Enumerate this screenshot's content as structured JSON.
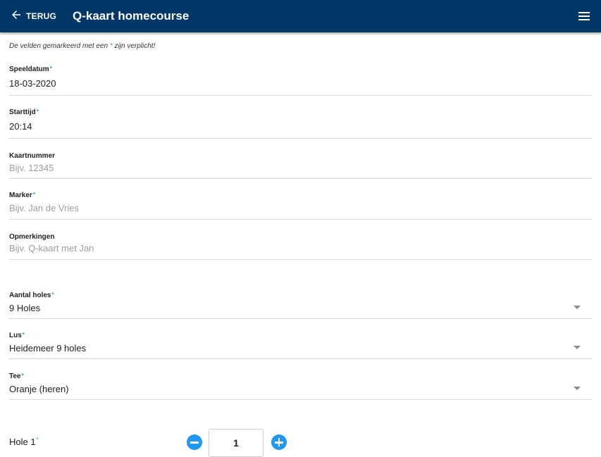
{
  "appbar": {
    "back_label": "TERUG",
    "title": "Q-kaart homecourse",
    "icons": {
      "back": "arrow-left-icon",
      "menu": "hamburger-menu-icon"
    }
  },
  "form": {
    "required_note_before": "De velden gemarkeerd met een ",
    "required_star": "*",
    "required_note_after": " zijn verplicht!",
    "fields": {
      "speeldatum": {
        "label": "Speeldatum",
        "value": "18-03-2020"
      },
      "starttijd": {
        "label": "Starttijd",
        "value": "20:14"
      },
      "kaartnummer": {
        "label": "Kaartnummer",
        "placeholder": "Bijv. 12345"
      },
      "marker": {
        "label": "Marker",
        "placeholder": "Bijv. Jan de Vries"
      },
      "opmerkingen": {
        "label": "Opmerkingen",
        "placeholder": "Bijv. Q-kaart met Jan"
      },
      "aantal_holes": {
        "label": "Aantal holes",
        "value": "9 Holes"
      },
      "lus": {
        "label": "Lus",
        "value": "Heidemeer 9 holes"
      },
      "tee": {
        "label": "Tee",
        "value": "Oranje (heren)"
      }
    },
    "hole": {
      "label": "Hole 1",
      "value": "1"
    }
  },
  "colors": {
    "appbar": "#003767",
    "accent": "#2196f3",
    "divider": "#d9d9d9"
  }
}
